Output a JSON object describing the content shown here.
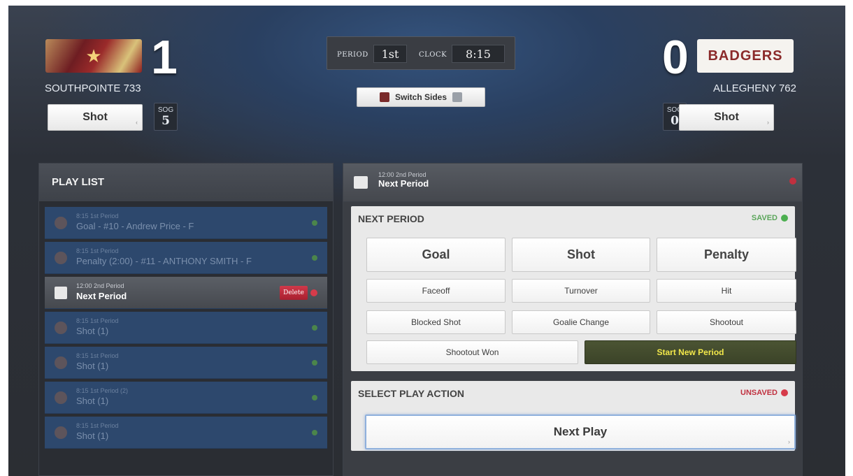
{
  "home": {
    "score": "1",
    "name": "SOUTHPOINTE 733",
    "shot_label": "Shot",
    "sog_label": "SOG",
    "sog_value": "5"
  },
  "away": {
    "score": "0",
    "name": "ALLEGHENY 762",
    "shot_label": "Shot",
    "sog_label": "SOG",
    "sog_value": "0",
    "logo_text": "BADGERS"
  },
  "clock": {
    "period_label": "PERIOD",
    "period_value": "1st",
    "clock_label": "CLOCK",
    "clock_value": "8:15"
  },
  "switch_sides_label": "Switch Sides",
  "playlist": {
    "title": "PLAY LIST",
    "items": [
      {
        "meta": "8:15 1st Period",
        "title": "Goal - #10 - Andrew Price - F"
      },
      {
        "meta": "8:15 1st Period",
        "title": "Penalty (2:00) - #11 - ANTHONY SMITH - F"
      },
      {
        "meta": "12:00 2nd Period",
        "title": "Next Period",
        "delete_label": "Delete"
      },
      {
        "meta": "8:15 1st Period",
        "title": "Shot (1)"
      },
      {
        "meta": "8:15 1st Period",
        "title": "Shot (1)"
      },
      {
        "meta": "8:15 1st Period (2)",
        "title": "Shot (1)"
      },
      {
        "meta": "8:15 1st Period",
        "title": "Shot (1)"
      }
    ]
  },
  "detail": {
    "meta": "12:00 2nd Period",
    "title": "Next Period"
  },
  "next_period_card": {
    "title": "NEXT PERIOD",
    "status": "SAVED",
    "buttons": {
      "goal": "Goal",
      "shot": "Shot",
      "penalty": "Penalty",
      "faceoff": "Faceoff",
      "turnover": "Turnover",
      "hit": "Hit",
      "blocked_shot": "Blocked Shot",
      "goalie_change": "Goalie Change",
      "shootout": "Shootout",
      "shootout_won": "Shootout Won",
      "start_new_period": "Start New Period"
    }
  },
  "select_play_card": {
    "title": "SELECT PLAY ACTION",
    "status": "UNSAVED",
    "selected": "Next Play"
  },
  "colors": {
    "saved": "#4caf50",
    "unsaved": "#d63b4a",
    "start_period_text": "#f2e84a",
    "highlight": "#f4f03a"
  }
}
